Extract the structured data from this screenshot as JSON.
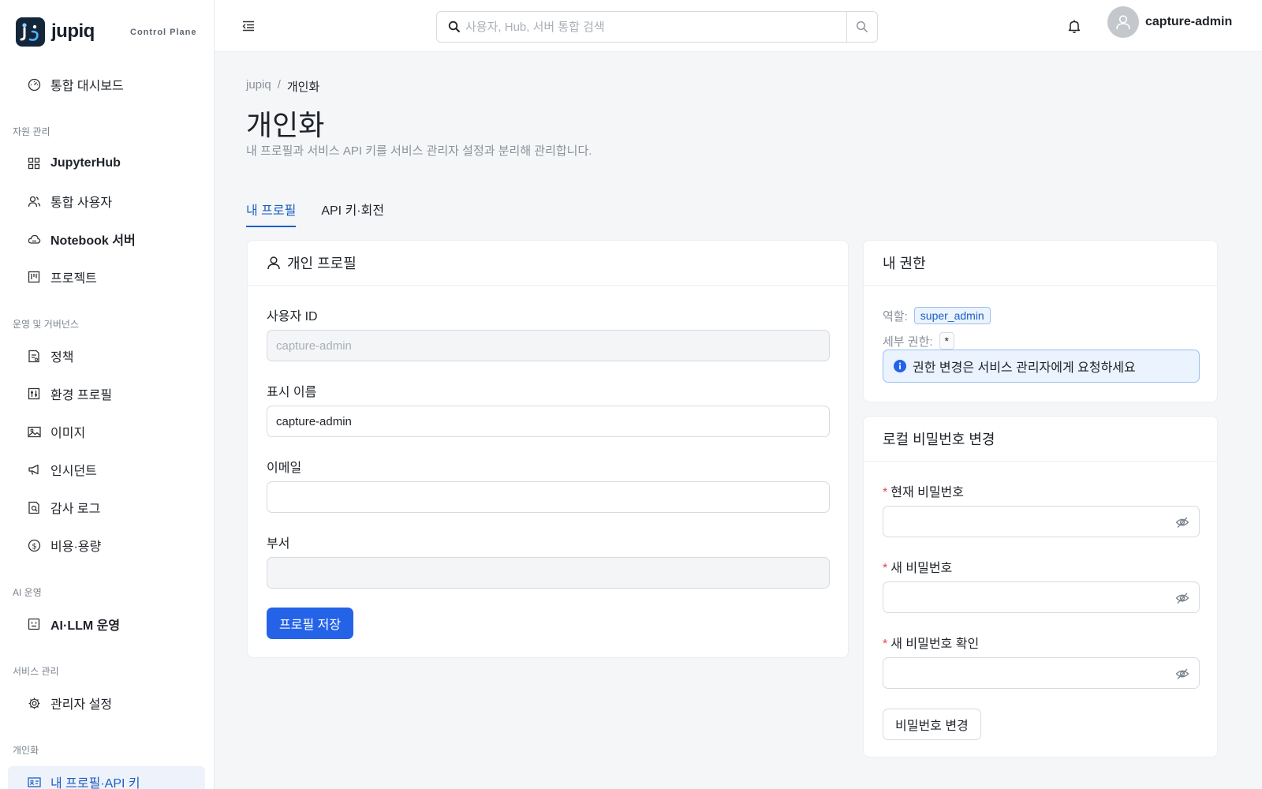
{
  "brand": {
    "name": "jupiq",
    "subtitle": "Control Plane"
  },
  "sidebar": {
    "top_item": {
      "label": "통합 대시보드",
      "icon": "dashboard-icon"
    },
    "sections": [
      {
        "title": "자원 관리",
        "items": [
          {
            "label": "JupyterHub",
            "icon": "grid-icon"
          },
          {
            "label": "통합 사용자",
            "icon": "users-icon"
          },
          {
            "label": "Notebook 서버",
            "icon": "cloud-icon"
          },
          {
            "label": "프로젝트",
            "icon": "project-board-icon"
          }
        ]
      },
      {
        "title": "운영 및 거버넌스",
        "items": [
          {
            "label": "정책",
            "icon": "policy-icon"
          },
          {
            "label": "환경 프로필",
            "icon": "sliders-icon"
          },
          {
            "label": "이미지",
            "icon": "image-icon"
          },
          {
            "label": "인시던트",
            "icon": "megaphone-icon"
          },
          {
            "label": "감사 로그",
            "icon": "audit-icon"
          },
          {
            "label": "비용·용량",
            "icon": "dollar-icon"
          }
        ]
      },
      {
        "title": "AI 운영",
        "items": [
          {
            "label": "AI·LLM 운영",
            "icon": "robot-icon"
          }
        ]
      },
      {
        "title": "서비스 관리",
        "items": [
          {
            "label": "관리자 설정",
            "icon": "gear-icon"
          }
        ]
      },
      {
        "title": "개인화",
        "items": [
          {
            "label": "내 프로필·API 키",
            "icon": "id-card-icon",
            "active": true
          }
        ]
      }
    ]
  },
  "topbar": {
    "search_placeholder": "사용자, Hub, 서버 통합 검색",
    "user_name": "capture-admin"
  },
  "breadcrumb": {
    "root": "jupiq",
    "separator": "/",
    "current": "개인화"
  },
  "page": {
    "title": "개인화",
    "description": "내 프로필과 서비스 API 키를 서비스 관리자 설정과 분리해 관리합니다."
  },
  "tabs": [
    {
      "label": "내 프로필",
      "active": true
    },
    {
      "label": "API 키·회전",
      "active": false
    }
  ],
  "profile_card": {
    "title": "개인 프로필",
    "user_id_label": "사용자 ID",
    "user_id_value": "capture-admin",
    "display_name_label": "표시 이름",
    "display_name_value": "capture-admin",
    "email_label": "이메일",
    "email_value": "",
    "department_label": "부서",
    "department_value": "",
    "save_label": "프로필 저장"
  },
  "permissions_card": {
    "title": "내 권한",
    "role_label": "역할:",
    "role_value": "super_admin",
    "detail_label": "세부 권한:",
    "detail_value": "*",
    "notice": "권한 변경은 서비스 관리자에게 요청하세요"
  },
  "password_card": {
    "title": "로컬 비밀번호 변경",
    "required_mark": "*",
    "current_label": "현재 비밀번호",
    "new_label": "새 비밀번호",
    "confirm_label": "새 비밀번호 확인",
    "submit_label": "비밀번호 변경"
  },
  "colors": {
    "accent": "#2463e8",
    "active_text": "#1d5fc2",
    "brand_logo": "#14263a"
  }
}
